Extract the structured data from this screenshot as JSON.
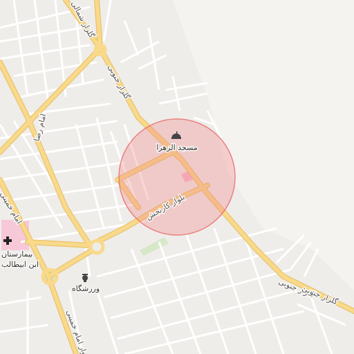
{
  "map": {
    "colors": {
      "land": "#f5f3f0",
      "minor_road": "#ffffff",
      "major_road": "#f9d98a",
      "major_road_casing": "#e8c36d",
      "park": "#d6e8c8",
      "hospital_area": "#f7c8d8",
      "circle_fill": "#f08a8a",
      "circle_stroke": "#e86a6a"
    },
    "labels": {
      "road_north": "گلزار شمالی",
      "road_south_1": "گلزار جنوبی",
      "road_south_2": "گلزار جنوبی",
      "road_south_3": "گلزار جنوبی",
      "blvd": "بلوار کارنجش",
      "imam_reza": "امام رضا",
      "imam_khomeini_1": "امام خمینی",
      "imam_khomeini_2": "بلوار امام خمینی"
    },
    "pois": {
      "mosque": {
        "name": "مسجد الزهرا",
        "icon": "mosque-icon"
      },
      "hospital": {
        "name_line1": "بیمارستان",
        "name_line2": "ابن ابیطالب",
        "icon": "hospital-cross-icon"
      },
      "stadium": {
        "name": "ورزشگاه",
        "icon": "stadium-icon"
      }
    }
  }
}
